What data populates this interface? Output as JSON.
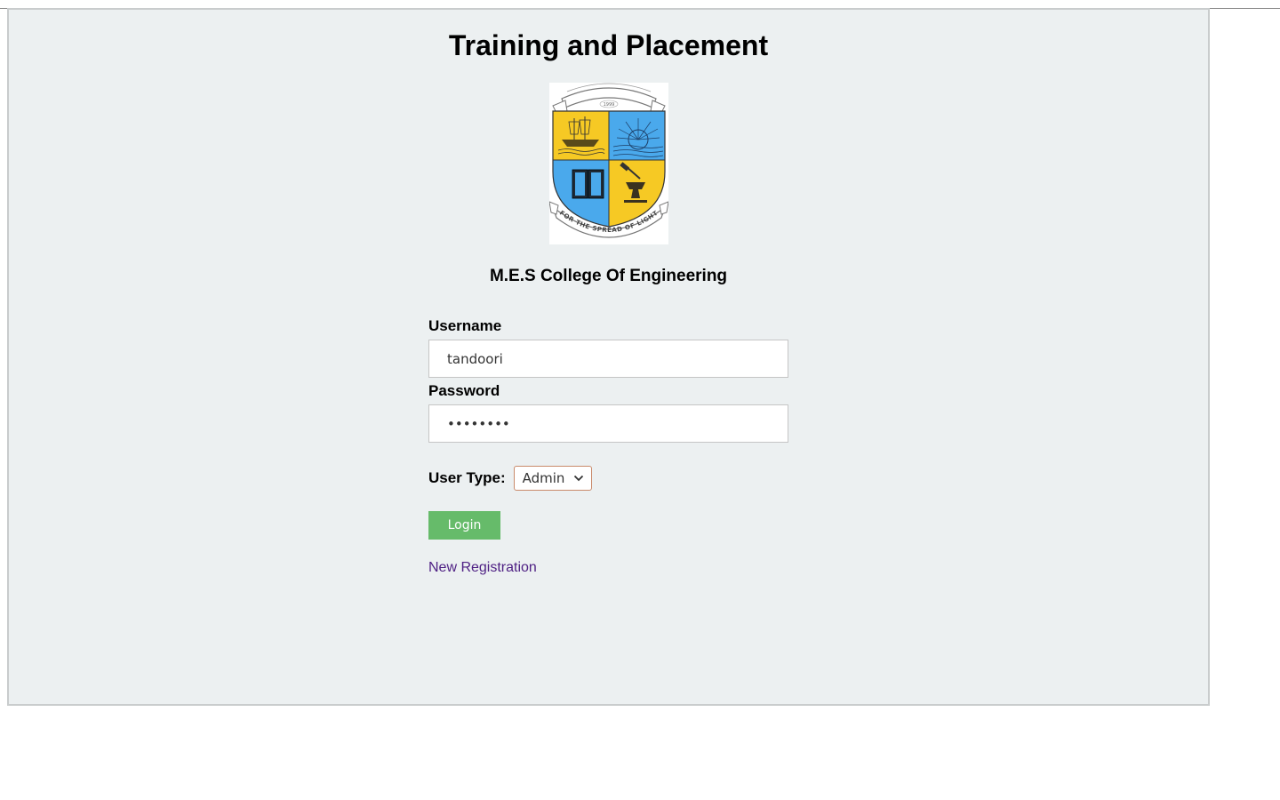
{
  "page": {
    "title": "Training and Placement",
    "college_name": "M.E.S College Of Engineering",
    "logo": {
      "icon": "college-crest-icon",
      "year": "1999",
      "motto": "FOR THE SPREAD OF LIGHT"
    }
  },
  "form": {
    "username_label": "Username",
    "username_value": "tandoori",
    "password_label": "Password",
    "password_value": "••••••••",
    "user_type_label": "User Type:",
    "user_type_selected": "Admin",
    "login_label": "Login",
    "register_label": "New Registration"
  },
  "colors": {
    "panel_bg": "#ecf0f1",
    "login_button": "#66bb6a",
    "link": "#4f2184",
    "crest_yellow": "#f6c924",
    "crest_blue": "#4aa9ec"
  }
}
